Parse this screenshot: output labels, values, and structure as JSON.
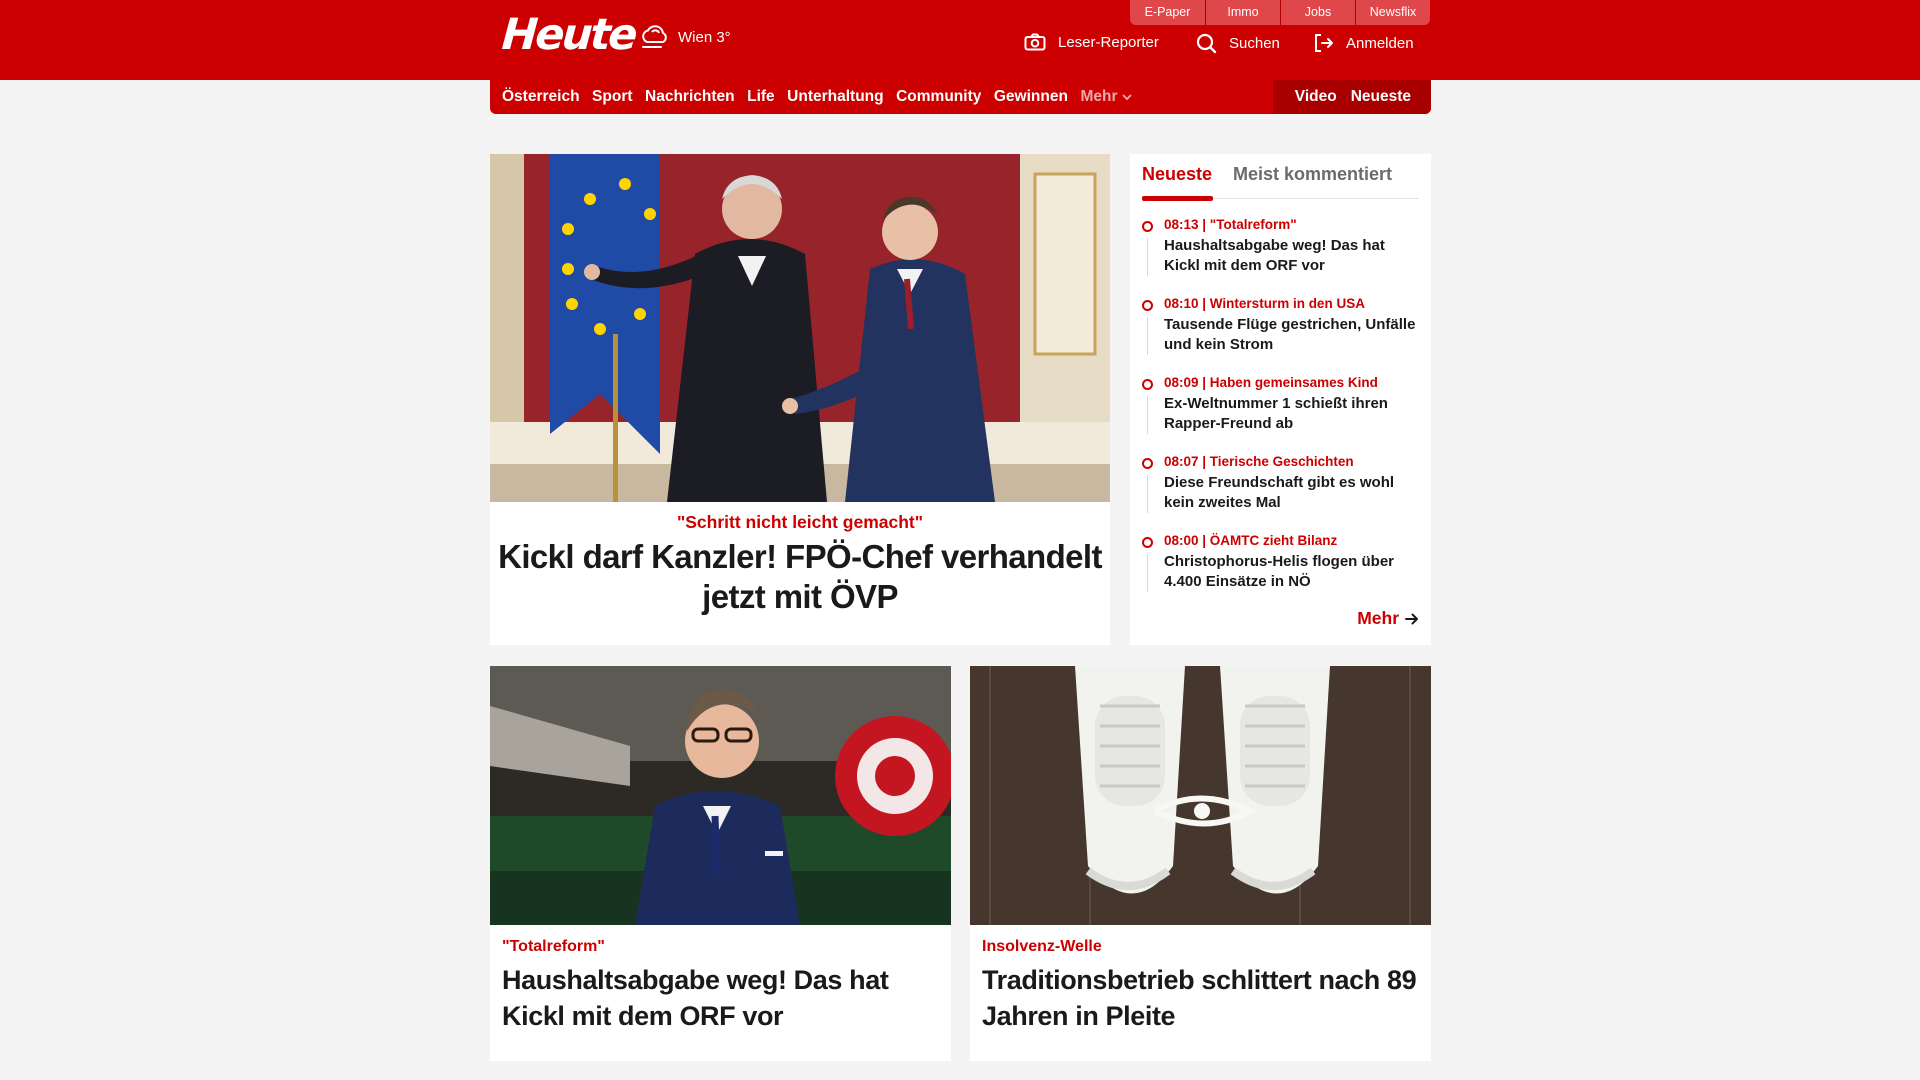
{
  "header": {
    "logo": "Heute",
    "weather": "Wien 3°",
    "top_links": [
      "E-Paper",
      "Immo",
      "Jobs",
      "Newsflix"
    ],
    "reporter_label": "Leser-Reporter",
    "search_label": "Suchen",
    "login_label": "Anmelden"
  },
  "nav": {
    "items": [
      "Österreich",
      "Sport",
      "Nachrichten",
      "Life",
      "Unterhaltung",
      "Community",
      "Gewinnen"
    ],
    "more_label": "Mehr",
    "video_label": "Video",
    "latest_label": "Neueste"
  },
  "hero": {
    "kicker": "\"Schritt nicht leicht gemacht\"",
    "title": "Kickl darf Kanzler! FPÖ-Chef verhandelt jetzt mit ÖVP"
  },
  "sidebar": {
    "tab_active": "Neueste",
    "tab_inactive": "Meist kommentiert",
    "items": [
      {
        "meta": "08:13 | \"Totalreform\"",
        "title": "Haushaltsabgabe weg! Das hat Kickl mit dem ORF vor"
      },
      {
        "meta": "08:10 | Wintersturm in den USA",
        "title": "Tausende Flüge gestrichen, Unfälle und kein Strom"
      },
      {
        "meta": "08:09 | Haben gemeinsames Kind",
        "title": "Ex-Weltnummer 1 schießt ihren Rapper-Freund ab"
      },
      {
        "meta": "08:07 | Tierische Geschichten",
        "title": "Diese Freundschaft gibt es wohl kein zweites Mal"
      },
      {
        "meta": "08:00 | ÖAMTC zieht Bilanz",
        "title": "Christophorus-Helis flogen über 4.400 Einsätze in NÖ"
      }
    ],
    "more_label": "Mehr"
  },
  "cards": [
    {
      "kicker": "\"Totalreform\"",
      "title": "Haushaltsabgabe weg! Das hat Kickl mit dem ORF vor"
    },
    {
      "kicker": "Insolvenz-Welle",
      "title": "Traditionsbetrieb schlittert nach 89 Jahren in Pleite"
    }
  ],
  "colors": {
    "brand_red": "#cc0000",
    "dark_red": "#a80000",
    "background": "#f4f4f4"
  },
  "icons": [
    "weather-cloud-icon",
    "camera-icon",
    "search-icon",
    "login-icon",
    "chevron-down-icon",
    "arrow-right-icon"
  ]
}
